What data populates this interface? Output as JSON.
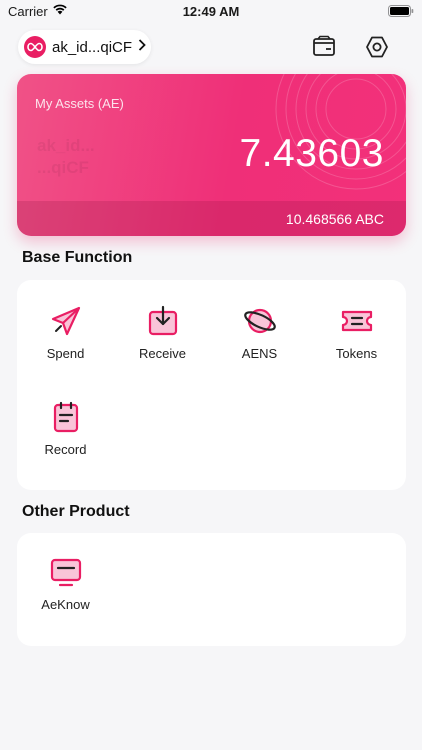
{
  "status_bar": {
    "carrier": "Carrier",
    "time": "12:49 AM"
  },
  "account": {
    "address": "ak_id...qiCF"
  },
  "asset_card": {
    "label": "My Assets (AE)",
    "balance": "7.43603",
    "token_balance": "10.468566 ABC",
    "faint_line1": "ak_id...",
    "faint_line2": "...qiCF"
  },
  "base_function": {
    "title": "Base Function",
    "items": [
      {
        "label": "Spend",
        "icon": "send-icon"
      },
      {
        "label": "Receive",
        "icon": "receive-icon"
      },
      {
        "label": "AENS",
        "icon": "planet-icon"
      },
      {
        "label": "Tokens",
        "icon": "ticket-icon"
      },
      {
        "label": "Record",
        "icon": "clipboard-icon"
      }
    ]
  },
  "other_product": {
    "title": "Other Product",
    "items": [
      {
        "label": "AeKnow",
        "icon": "monitor-icon"
      }
    ]
  },
  "colors": {
    "accent": "#e91e63",
    "background": "#f6f6f8"
  }
}
